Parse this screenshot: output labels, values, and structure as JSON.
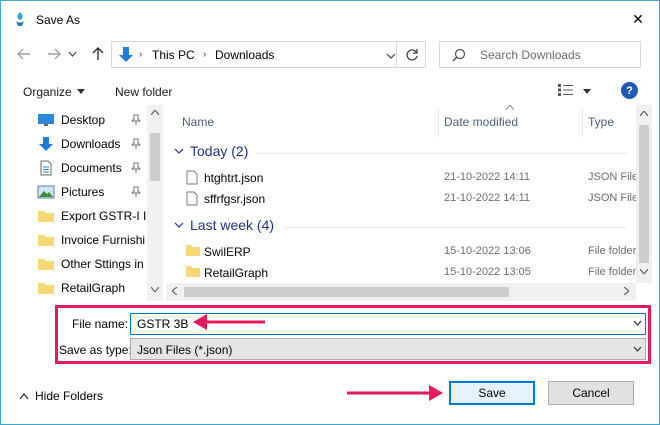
{
  "window": {
    "title": "Save As",
    "close_glyph": "✕"
  },
  "address_bar": {
    "crumbs": [
      "This PC",
      "Downloads"
    ],
    "separator": "›",
    "search_placeholder": "Search Downloads"
  },
  "toolbar": {
    "organize_label": "Organize",
    "new_folder_label": "New folder",
    "help_label": "?"
  },
  "nav_pane": {
    "items": [
      {
        "label": "Desktop",
        "icon": "desktop-icon",
        "pinned": true
      },
      {
        "label": "Downloads",
        "icon": "downloads-icon",
        "pinned": true
      },
      {
        "label": "Documents",
        "icon": "documents-icon",
        "pinned": true
      },
      {
        "label": "Pictures",
        "icon": "pictures-icon",
        "pinned": true
      },
      {
        "label": "Export GSTR-I In",
        "icon": "folder-icon",
        "pinned": false
      },
      {
        "label": "Invoice Furnishi",
        "icon": "folder-icon",
        "pinned": false
      },
      {
        "label": "Other Sttings in S",
        "icon": "folder-icon",
        "pinned": false
      },
      {
        "label": "RetailGraph",
        "icon": "folder-icon",
        "pinned": false
      }
    ]
  },
  "file_list": {
    "columns": [
      "Name",
      "Date modified",
      "Type"
    ],
    "groups": [
      {
        "label": "Today (2)",
        "files": [
          {
            "name": "htghtrt.json",
            "date": "21-10-2022 14:11",
            "type": "JSON File",
            "icon": "file-icon"
          },
          {
            "name": "sffrfgsr.json",
            "date": "21-10-2022 14:11",
            "type": "JSON File",
            "icon": "file-icon"
          }
        ]
      },
      {
        "label": "Last week (4)",
        "files": [
          {
            "name": "SwilERP",
            "date": "15-10-2022 13:06",
            "type": "File folder",
            "icon": "folder-icon"
          },
          {
            "name": "RetailGraph",
            "date": "15-10-2022 13:05",
            "type": "File folder",
            "icon": "folder-icon"
          }
        ]
      }
    ]
  },
  "form": {
    "file_name_label": "File name:",
    "file_name_value": "GSTR 3B",
    "save_as_type_label": "Save as type:",
    "save_as_type_value": "Json Files (*.json)"
  },
  "footer": {
    "hide_folders_label": "Hide Folders",
    "save_label": "Save",
    "cancel_label": "Cancel"
  },
  "colors": {
    "highlight": "#e8195a",
    "accent": "#0078d7",
    "group_header": "#1e3287",
    "folder": "#f8d775"
  }
}
